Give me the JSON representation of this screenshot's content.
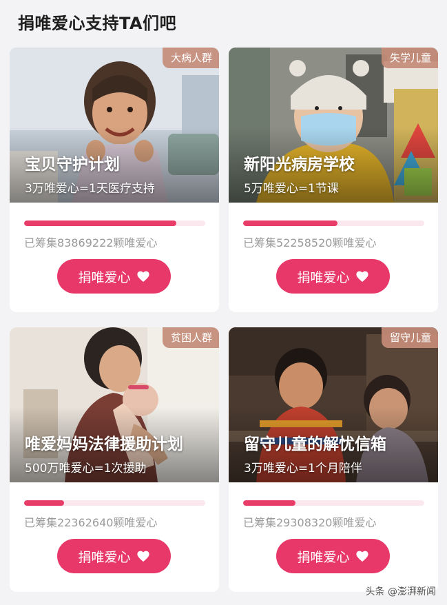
{
  "page": {
    "title": "捐唯爱心支持TA们吧"
  },
  "projects": [
    {
      "tag": "大病人群",
      "title": "宝贝守护计划",
      "subtitle": "3万唯爱心=1天医疗支持",
      "raised": "已筹集83869222颗唯爱心",
      "progress": 0.84,
      "button": "捐唯爱心"
    },
    {
      "tag": "失学儿童",
      "title": "新阳光病房学校",
      "subtitle": "5万唯爱心=1节课",
      "raised": "已筹集52258520颗唯爱心",
      "progress": 0.52,
      "button": "捐唯爱心"
    },
    {
      "tag": "贫困人群",
      "title": "唯爱妈妈法律援助计划",
      "subtitle": "500万唯爱心=1次援助",
      "raised": "已筹集22362640颗唯爱心",
      "progress": 0.22,
      "button": "捐唯爱心"
    },
    {
      "tag": "留守儿童",
      "title": "留守儿童的解忧信箱",
      "subtitle": "3万唯爱心=1个月陪伴",
      "raised": "已筹集29308320颗唯爱心",
      "progress": 0.29,
      "button": "捐唯爱心"
    }
  ],
  "watermark": "头条 @澎湃新闻",
  "colors": {
    "accent": "#e8386a",
    "track": "#fbe8ee",
    "tag": "#c48c78"
  },
  "icons": {
    "button": "heart-icon"
  }
}
